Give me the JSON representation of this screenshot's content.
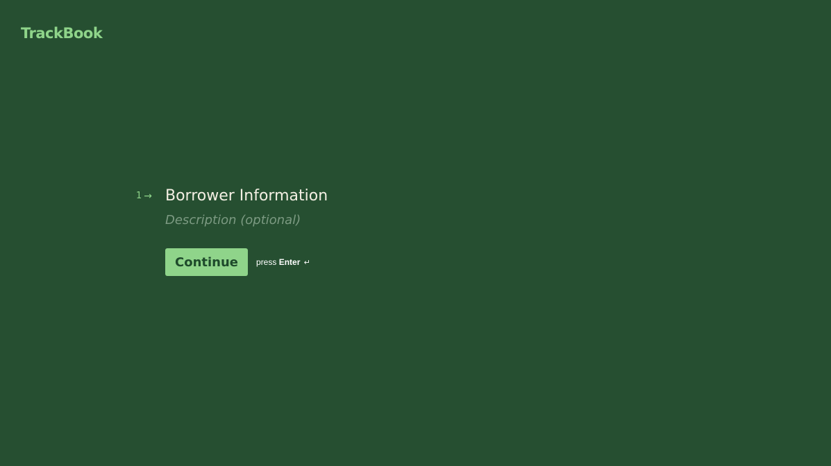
{
  "brand": {
    "name": "TrackBook"
  },
  "question": {
    "number": "1",
    "arrow": "→",
    "title": "Borrower Information",
    "description_placeholder": "Description (optional)"
  },
  "actions": {
    "continue_label": "Continue",
    "hint_prefix": "press",
    "hint_key": "Enter",
    "hint_icon": "↵"
  },
  "colors": {
    "background": "#264f31",
    "accent": "#8fd48a",
    "title_text": "#f3efe3",
    "muted_text": "#7c9a82"
  }
}
